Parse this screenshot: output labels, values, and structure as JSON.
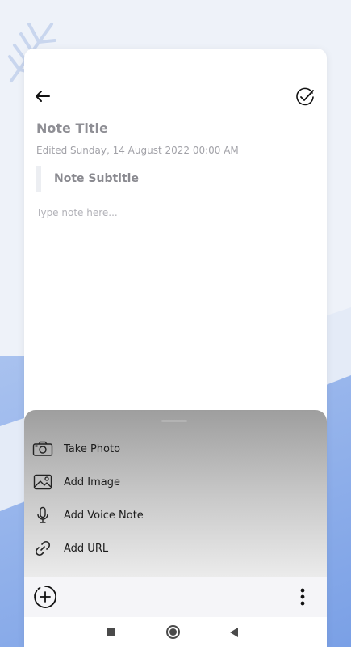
{
  "note": {
    "title_placeholder": "Note Title",
    "edited_text": "Edited Sunday, 14 August 2022 00:00 AM",
    "subtitle_placeholder": "Note Subtitle",
    "body_placeholder": "Type note here..."
  },
  "header": {
    "back_icon": "arrow-left-icon",
    "done_icon": "check-circle-icon"
  },
  "sheet": {
    "items": [
      {
        "label": "Take Photo",
        "icon": "camera-icon"
      },
      {
        "label": "Add Image",
        "icon": "image-icon"
      },
      {
        "label": "Add Voice Note",
        "icon": "microphone-icon"
      },
      {
        "label": "Add URL",
        "icon": "link-icon"
      }
    ]
  },
  "bottom_bar": {
    "add_icon": "add-circle-dashed-icon",
    "more_icon": "more-vertical-icon"
  },
  "system_nav": {
    "recents_icon": "square-icon",
    "home_icon": "home-circle-icon",
    "back_icon": "triangle-back-icon"
  },
  "colors": {
    "background_blue": "#7aa0e6",
    "card": "#ffffff",
    "sheet_top": "#9e9e9e",
    "text_primary": "#1c1c1c",
    "text_placeholder": "#8f8f95"
  }
}
